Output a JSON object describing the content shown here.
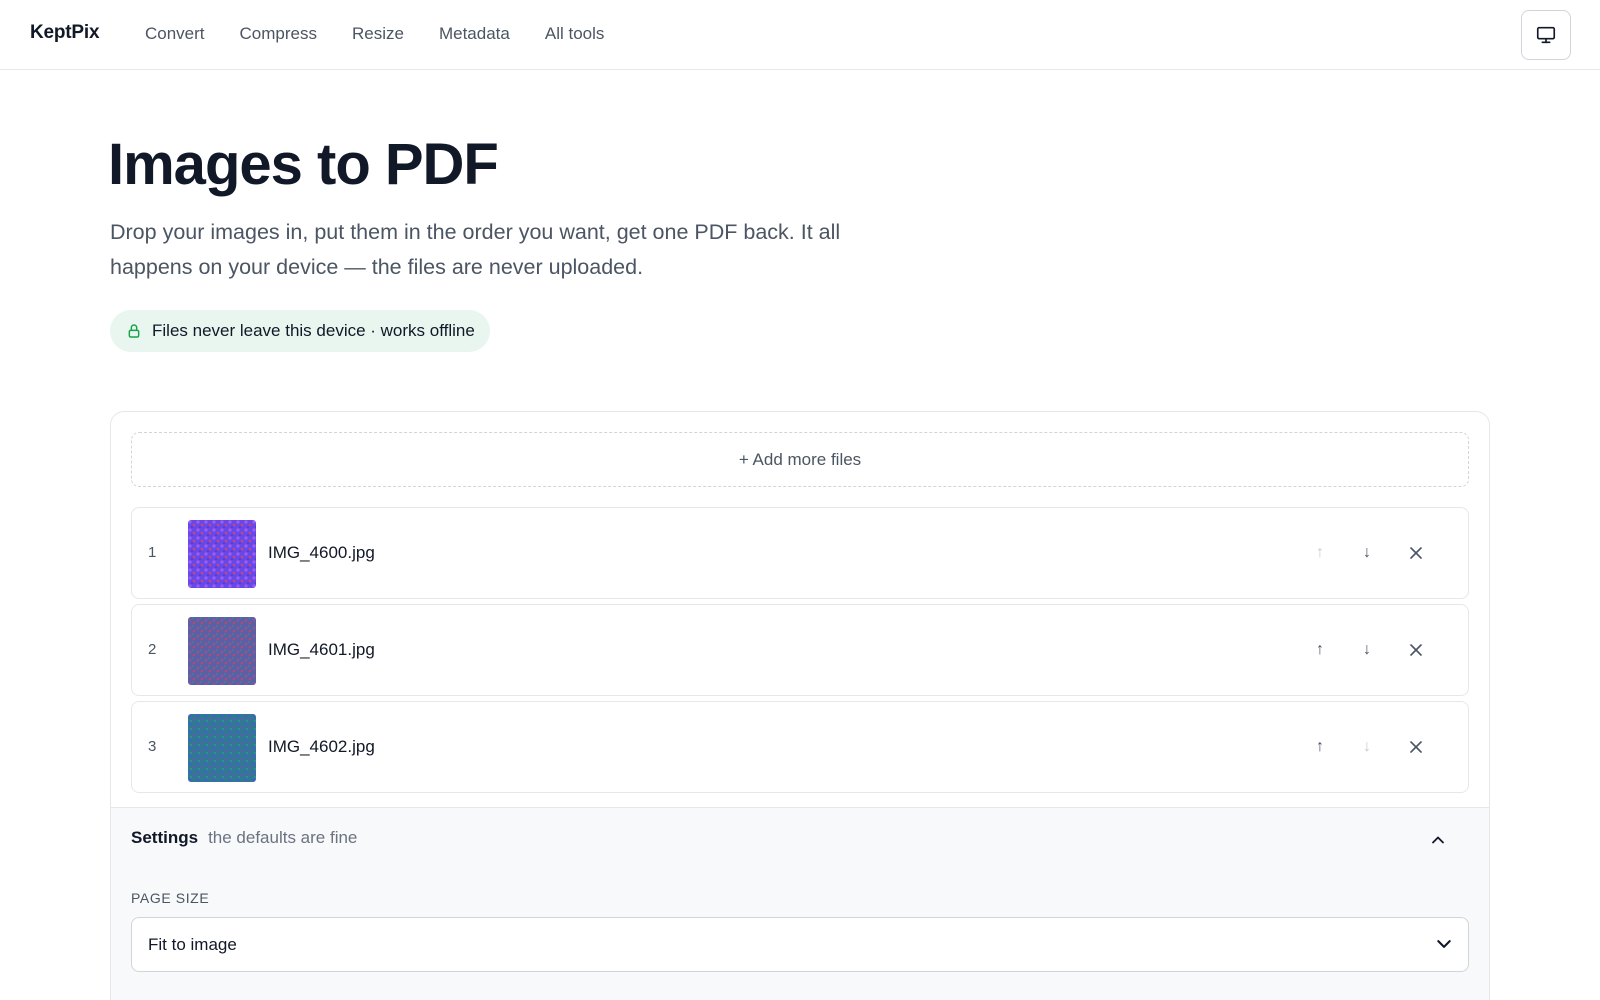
{
  "brand": "KeptPix",
  "nav": {
    "items": [
      "Convert",
      "Compress",
      "Resize",
      "Metadata",
      "All tools"
    ]
  },
  "display_button": {
    "icon": "monitor-icon"
  },
  "hero": {
    "title": "Images to PDF",
    "description": "Drop your images in, put them in the order you want, get one PDF back. It all happens on your device — the files are never uploaded.",
    "badge": {
      "icon": "lock-icon",
      "text": "Files never leave this device · works offline",
      "color": "#e8f6ef",
      "icon_color": "#16a34a"
    }
  },
  "upload": {
    "add_more_label": "+ Add more files"
  },
  "files": [
    {
      "index": "1",
      "name": "IMG_4600.jpg",
      "thumb_colors": [
        "#5b3fd6",
        "#7b4bf0",
        "#c0407a"
      ],
      "up_enabled": false,
      "down_enabled": true
    },
    {
      "index": "2",
      "name": "IMG_4601.jpg",
      "thumb_colors": [
        "#4e63a8",
        "#7a5a9a",
        "#c04a6a"
      ],
      "up_enabled": true,
      "down_enabled": true
    },
    {
      "index": "3",
      "name": "IMG_4602.jpg",
      "thumb_colors": [
        "#2a7f8f",
        "#3a5fc0",
        "#6a5ab0"
      ],
      "up_enabled": true,
      "down_enabled": false
    }
  ],
  "row_actions": {
    "up_icon": "arrow-up-icon",
    "down_icon": "arrow-down-icon",
    "remove_icon": "close-icon",
    "up_glyph": "↑",
    "down_glyph": "↓"
  },
  "settings": {
    "title": "Settings",
    "subtitle": "the defaults are fine",
    "page_size_label": "PAGE SIZE",
    "page_size_value": "Fit to image"
  }
}
